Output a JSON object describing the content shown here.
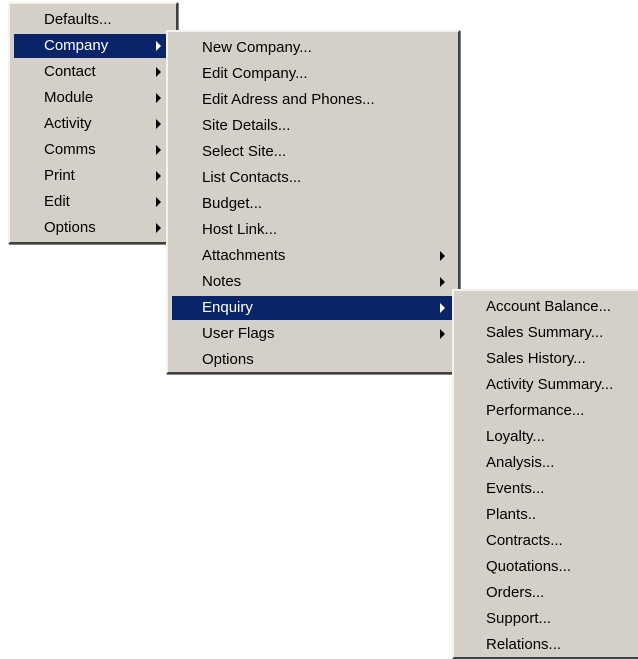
{
  "main_menu": {
    "items": [
      {
        "label": "Defaults...",
        "submenu": false
      },
      {
        "label": "Company",
        "submenu": true,
        "selected": true
      },
      {
        "label": "Contact",
        "submenu": true
      },
      {
        "label": "Module",
        "submenu": true
      },
      {
        "label": "Activity",
        "submenu": true
      },
      {
        "label": "Comms",
        "submenu": true
      },
      {
        "label": "Print",
        "submenu": true
      },
      {
        "label": "Edit",
        "submenu": true
      },
      {
        "label": "Options",
        "submenu": true
      }
    ]
  },
  "company_menu": {
    "items": [
      {
        "label": "New Company...",
        "submenu": false
      },
      {
        "label": "Edit Company...",
        "submenu": false
      },
      {
        "label": "Edit Adress and Phones...",
        "submenu": false
      },
      {
        "label": "Site Details...",
        "submenu": false
      },
      {
        "label": "Select Site...",
        "submenu": false
      },
      {
        "label": "List Contacts...",
        "submenu": false
      },
      {
        "label": "Budget...",
        "submenu": false
      },
      {
        "label": "Host Link...",
        "submenu": false
      },
      {
        "label": "Attachments",
        "submenu": true
      },
      {
        "label": "Notes",
        "submenu": true
      },
      {
        "label": "Enquiry",
        "submenu": true,
        "selected": true
      },
      {
        "label": "User Flags",
        "submenu": true
      },
      {
        "label": "Options",
        "submenu": false
      }
    ]
  },
  "enquiry_menu": {
    "items": [
      {
        "label": "Account Balance..."
      },
      {
        "label": "Sales Summary..."
      },
      {
        "label": "Sales History..."
      },
      {
        "label": "Activity Summary..."
      },
      {
        "label": "Performance..."
      },
      {
        "label": "Loyalty..."
      },
      {
        "label": "Analysis..."
      },
      {
        "label": "Events..."
      },
      {
        "label": "Plants.."
      },
      {
        "label": "Contracts..."
      },
      {
        "label": "Quotations..."
      },
      {
        "label": "Orders..."
      },
      {
        "label": "Support..."
      },
      {
        "label": "Relations..."
      }
    ]
  },
  "colors": {
    "menu_face": "#d4d0c8",
    "highlight": "#0a246a",
    "highlight_text": "#ffffff"
  }
}
